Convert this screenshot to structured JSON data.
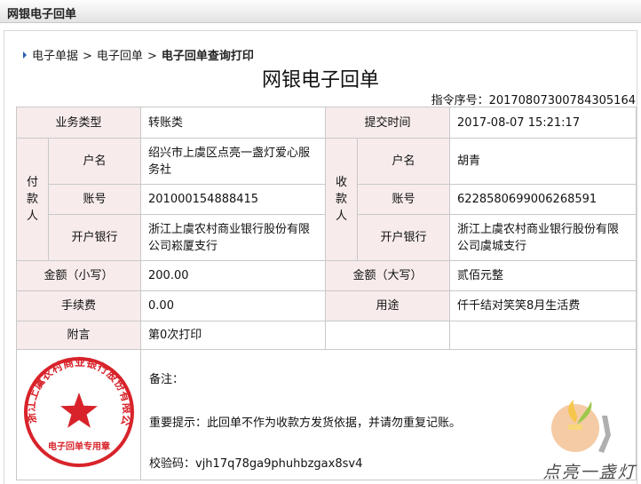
{
  "window": {
    "title": "网银电子回单"
  },
  "breadcrumb": {
    "items": [
      "电子单据",
      "电子回单"
    ],
    "separator": ">",
    "current": "电子回单查询打印"
  },
  "receipt": {
    "title": "网银电子回单",
    "serial": "指令序号：20170807300784305164",
    "business_type": {
      "label": "业务类型",
      "value": "转账类"
    },
    "submit_time": {
      "label": "提交时间",
      "value": "2017-08-07 15:21:17"
    },
    "payer": {
      "group_label": "付款人",
      "name_label": "户名",
      "name": "绍兴市上虞区点亮一盏灯爱心服务社",
      "account_label": "账号",
      "account": "201000154888415",
      "bank_label": "开户银行",
      "bank": "浙江上虞农村商业银行股份有限公司崧厦支行"
    },
    "payee": {
      "group_label": "收款人",
      "name_label": "户名",
      "name": "胡青",
      "account_label": "账号",
      "account": "6228580699006268591",
      "bank_label": "开户银行",
      "bank": "浙江上虞农村商业银行股份有限公司虞城支行"
    },
    "amount_small": {
      "label": "金额（小写）",
      "value": "200.00"
    },
    "amount_big": {
      "label": "金额（大写）",
      "value": "贰佰元整"
    },
    "fee": {
      "label": "手续费",
      "value": "0.00"
    },
    "purpose": {
      "label": "用途",
      "value": "仟千结对笑笑8月生活费"
    },
    "postscript": {
      "label": "附言",
      "value": "第0次打印"
    },
    "remark_label": "备注：",
    "notice": "重要提示：此回单不作为收款方发货依据，并请勿重复记账。",
    "check_code": "校验码：vjh17q78ga9phuhbzgax8sv4",
    "seal": {
      "text": "浙江上虞农村商业银行股份有限公司",
      "bottom_text": "电子回单专用章",
      "color": "#d8232a"
    }
  },
  "watermark": {
    "text": "点亮一盏灯"
  }
}
